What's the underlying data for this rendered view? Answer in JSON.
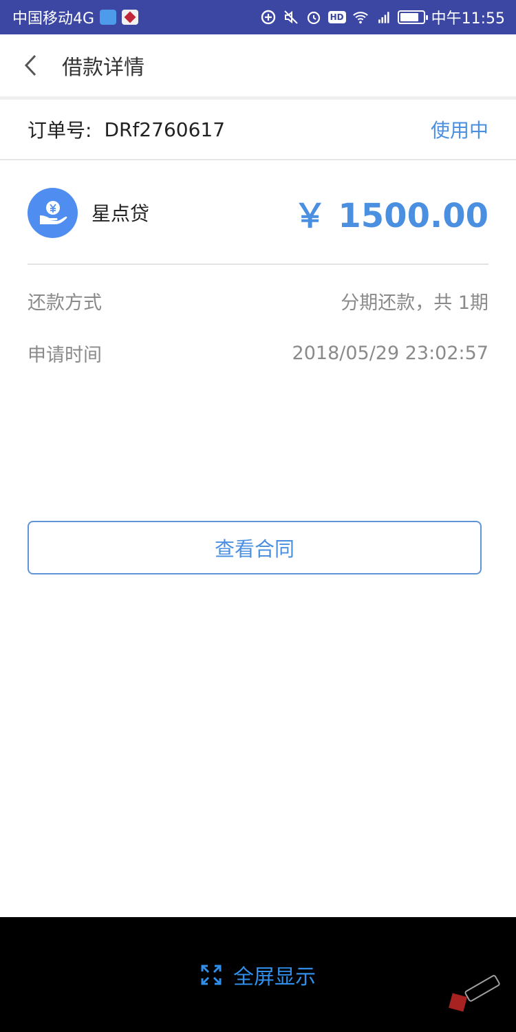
{
  "status_bar": {
    "carrier": "中国移动4G",
    "time": "中午11:55",
    "hd_label": "HD",
    "icons": [
      "app-badge-icon",
      "app-badge-red-icon",
      "data-saver-icon",
      "mute-icon",
      "alarm-icon",
      "hd-icon",
      "wifi-icon",
      "signal-4g-icon",
      "battery-icon"
    ]
  },
  "nav": {
    "title": "借款详情",
    "back_icon": "chevron-left-icon"
  },
  "order": {
    "label": "订单号:",
    "number": "DRf2760617",
    "status": "使用中"
  },
  "product": {
    "name": "星点贷",
    "amount": "￥ 1500.00",
    "icon": "yen-hand-icon"
  },
  "details": [
    {
      "label": "还款方式",
      "value": "分期还款，共 1期"
    },
    {
      "label": "申请时间",
      "value": "2018/05/29 23:02:57"
    }
  ],
  "contract_button": {
    "label": "查看合同"
  },
  "bottom": {
    "fullscreen_label": "全屏显示",
    "icon": "expand-icon"
  },
  "colors": {
    "status_bar": "#3b47a3",
    "accent": "#4a8fe0",
    "secondary_text": "#8a8a8a",
    "bottom_bar": "#000000",
    "fullscreen_text": "#2f8fea"
  }
}
